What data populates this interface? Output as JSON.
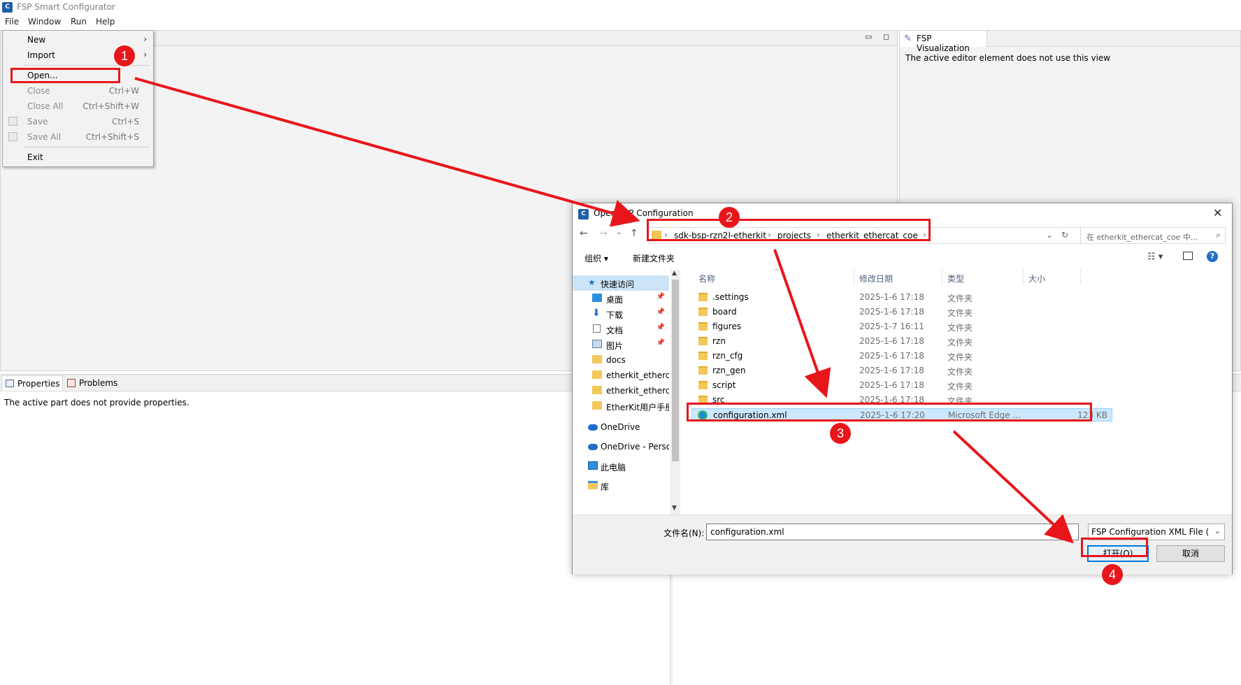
{
  "app": {
    "title": "FSP Smart Configurator",
    "icon_label": "C",
    "menus": [
      "File",
      "Window",
      "Run",
      "Help"
    ]
  },
  "file_menu": {
    "items": [
      {
        "label": "New",
        "shortcut": "",
        "arrow": "›"
      },
      {
        "label": "Import",
        "shortcut": "",
        "arrow": "›"
      },
      {
        "label": "Open...",
        "shortcut": ""
      },
      {
        "label": "Close",
        "shortcut": "Ctrl+W"
      },
      {
        "label": "Close All",
        "shortcut": "Ctrl+Shift+W"
      },
      {
        "label": "Save",
        "shortcut": "Ctrl+S"
      },
      {
        "label": "Save All",
        "shortcut": "Ctrl+Shift+S"
      },
      {
        "label": "Exit",
        "shortcut": ""
      }
    ]
  },
  "viz_panel": {
    "tab_label": "FSP Visualization",
    "message": "The active editor element does not use this view"
  },
  "bottom_panel": {
    "tabs": [
      "Properties",
      "Problems"
    ],
    "message": "The active part does not provide properties."
  },
  "dialog": {
    "title": "Open FSP Configuration",
    "close_glyph": "✕",
    "breadcrumbs": [
      "sdk-bsp-rzn2l-etherkit",
      "projects",
      "etherkit_ethercat_coe"
    ],
    "search_placeholder": "在 etherkit_ethercat_coe 中...",
    "toolbar": {
      "organize": "组织 ▾",
      "new_folder": "新建文件夹",
      "view": "☷ ▾",
      "help": "?"
    },
    "nav_items": [
      {
        "label": "快速访问",
        "pinned": false
      },
      {
        "label": "桌面",
        "pinned": true
      },
      {
        "label": "下载",
        "pinned": true
      },
      {
        "label": "文档",
        "pinned": true
      },
      {
        "label": "图片",
        "pinned": true
      },
      {
        "label": "docs",
        "pinned": false
      },
      {
        "label": "etherkit_etherc",
        "pinned": false
      },
      {
        "label": "etherkit_etherc",
        "pinned": false
      },
      {
        "label": "EtherKit用户手册",
        "pinned": false
      },
      {
        "label": "OneDrive",
        "pinned": false
      },
      {
        "label": "OneDrive - Perso",
        "pinned": false
      },
      {
        "label": "此电脑",
        "pinned": false
      },
      {
        "label": "库",
        "pinned": false
      }
    ],
    "columns": [
      "名称",
      "修改日期",
      "类型",
      "大小"
    ],
    "files": [
      {
        "name": ".settings",
        "date": "2025-1-6 17:18",
        "type": "文件夹",
        "size": ""
      },
      {
        "name": "board",
        "date": "2025-1-6 17:18",
        "type": "文件夹",
        "size": ""
      },
      {
        "name": "figures",
        "date": "2025-1-7 16:11",
        "type": "文件夹",
        "size": ""
      },
      {
        "name": "rzn",
        "date": "2025-1-6 17:18",
        "type": "文件夹",
        "size": ""
      },
      {
        "name": "rzn_cfg",
        "date": "2025-1-6 17:18",
        "type": "文件夹",
        "size": ""
      },
      {
        "name": "rzn_gen",
        "date": "2025-1-6 17:18",
        "type": "文件夹",
        "size": ""
      },
      {
        "name": "script",
        "date": "2025-1-6 17:18",
        "type": "文件夹",
        "size": ""
      },
      {
        "name": "src",
        "date": "2025-1-6 17:18",
        "type": "文件夹",
        "size": ""
      },
      {
        "name": "configuration.xml",
        "date": "2025-1-6 17:20",
        "type": "Microsoft Edge ...",
        "size": "123 KB"
      }
    ],
    "filename_label": "文件名(N):",
    "filename_value": "configuration.xml",
    "filetype": "FSP Configuration XML File (",
    "open_label": "打开(O)",
    "cancel_label": "取消"
  },
  "annotations": {
    "badges": [
      "1",
      "2",
      "3",
      "4"
    ],
    "color": "#e8161b"
  }
}
